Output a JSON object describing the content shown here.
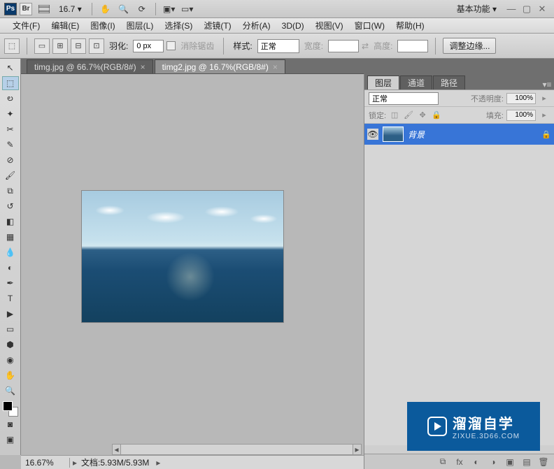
{
  "titlebar": {
    "ps": "Ps",
    "br": "Br",
    "zoom": "16.7 ▾",
    "workspace": "基本功能 ▾"
  },
  "menu": [
    "文件(F)",
    "编辑(E)",
    "图像(I)",
    "图层(L)",
    "选择(S)",
    "滤镜(T)",
    "分析(A)",
    "3D(D)",
    "视图(V)",
    "窗口(W)",
    "帮助(H)"
  ],
  "options": {
    "feather_label": "羽化:",
    "feather_value": "0 px",
    "antialias": "消除锯齿",
    "style_label": "样式:",
    "style_value": "正常",
    "width_label": "宽度:",
    "height_label": "高度:",
    "refine_edge": "调整边缘..."
  },
  "tabs": [
    {
      "label": "timg.jpg @ 66.7%(RGB/8#)",
      "active": false
    },
    {
      "label": "timg2.jpg @ 16.7%(RGB/8#)",
      "active": true
    }
  ],
  "status": {
    "zoom": "16.67%",
    "doc": "文档:5.93M/5.93M"
  },
  "panel": {
    "tabs": [
      "图层",
      "通道",
      "路径"
    ],
    "blend_mode": "正常",
    "opacity_label": "不透明度:",
    "opacity_value": "100%",
    "lock_label": "锁定:",
    "fill_label": "填充:",
    "fill_value": "100%",
    "layer_name": "背景"
  },
  "watermark": {
    "title": "溜溜自学",
    "sub": "ZIXUE.3D66.COM"
  }
}
